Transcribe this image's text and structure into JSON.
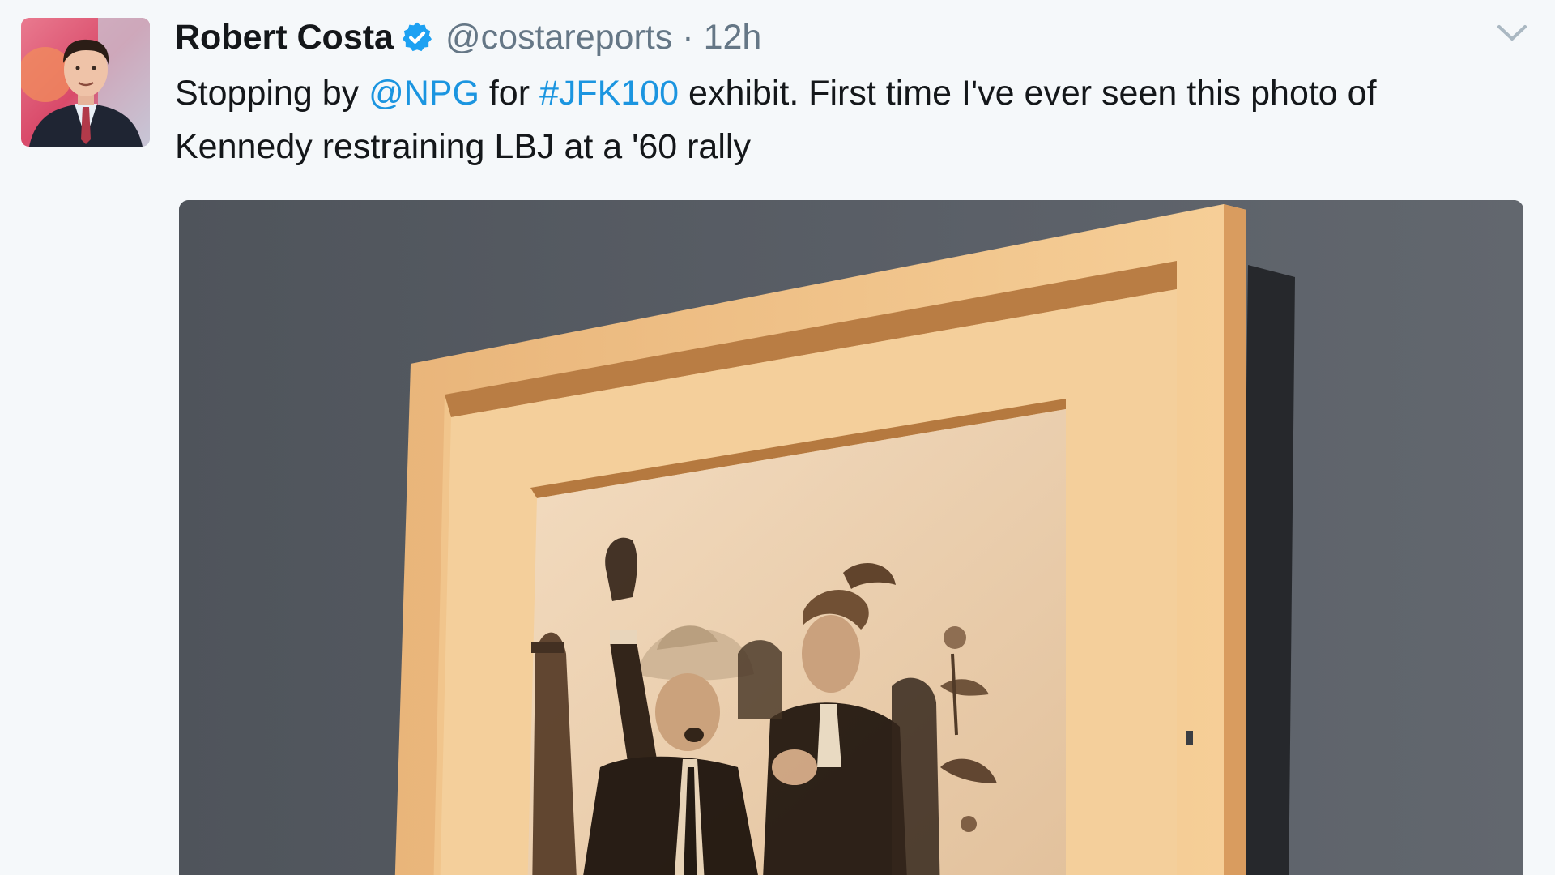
{
  "tweet": {
    "display_name": "Robert Costa",
    "handle": "@costareports",
    "separator": "·",
    "timestamp": "12h",
    "text": {
      "t1": "Stopping by ",
      "mention": "@NPG",
      "t2": " for ",
      "hashtag": "#JFK100",
      "t3": " exhibit. First time I've ever seen this photo of",
      "t4": "Kennedy restraining LBJ at a '60 rally"
    }
  },
  "icons": {
    "verified": "verified-badge-icon",
    "menu": "chevron-down-icon"
  },
  "colors": {
    "background": "#f5f8fa",
    "text": "#14171a",
    "secondary": "#657786",
    "link": "#1b95e0",
    "verified": "#1da1f2"
  }
}
